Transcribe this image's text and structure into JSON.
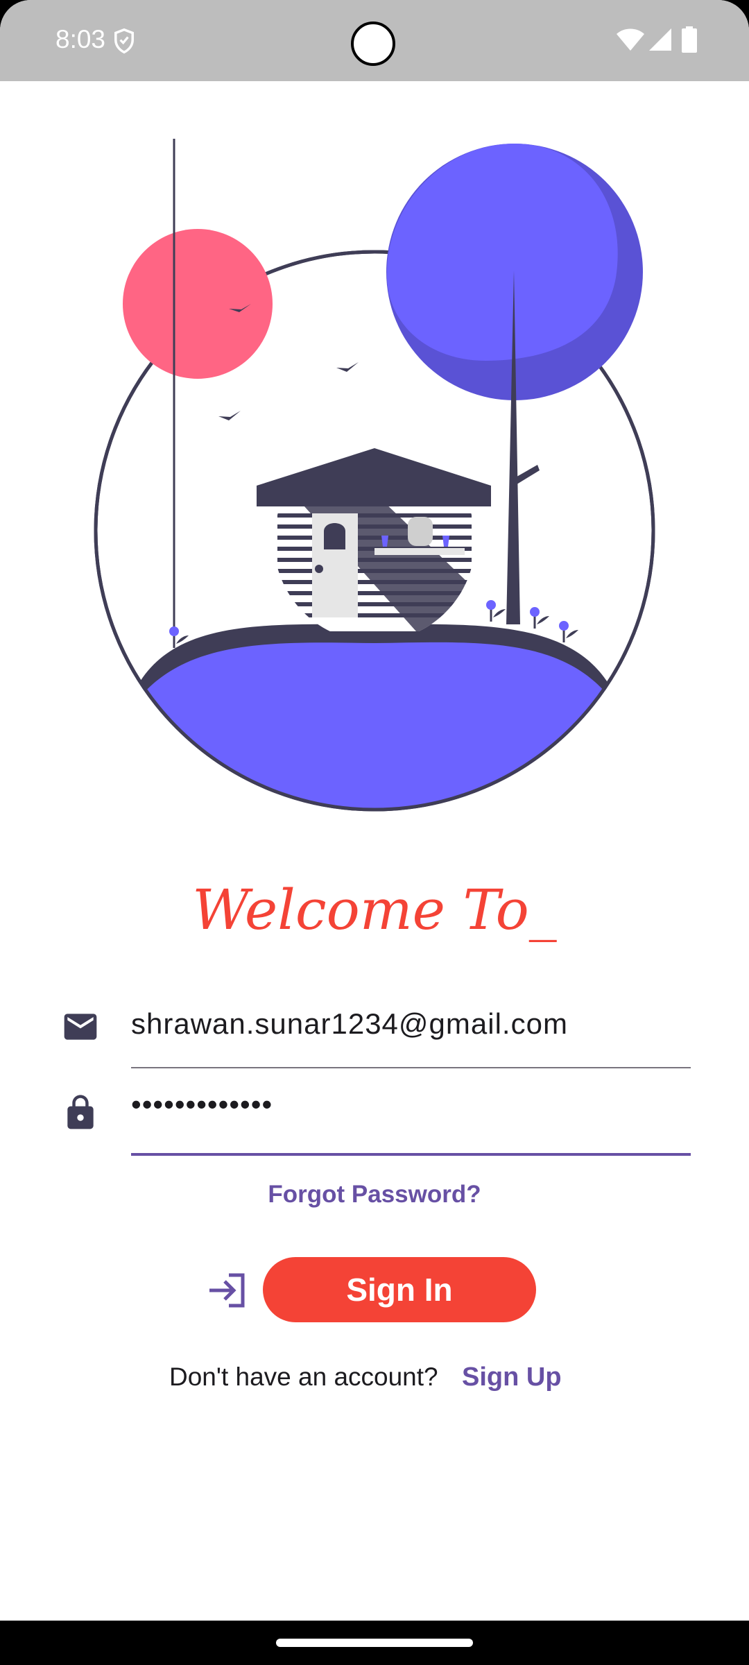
{
  "status_bar": {
    "time": "8:03",
    "icons": [
      "shield-icon",
      "wifi-icon",
      "signal-icon",
      "battery-icon"
    ]
  },
  "illustration": {
    "description_icon": "house-illustration",
    "colors": {
      "primary": "#6c63ff",
      "sun": "#ff6584",
      "dark": "#3f3d56"
    }
  },
  "welcome": {
    "title": "Welcome To_"
  },
  "form": {
    "email": {
      "value": "shrawan.sunar1234@gmail.com",
      "icon": "mail-icon"
    },
    "password": {
      "value": "•••••••••••••",
      "icon": "lock-icon"
    },
    "forgot_label": "Forgot Password?",
    "signin_label": "Sign In",
    "signin_icon": "login-icon"
  },
  "signup": {
    "prompt": "Don't have an account?",
    "link_label": "Sign Up"
  },
  "colors": {
    "accent": "#f44336",
    "primary": "#6750a4",
    "underline_inactive": "#79747e"
  }
}
